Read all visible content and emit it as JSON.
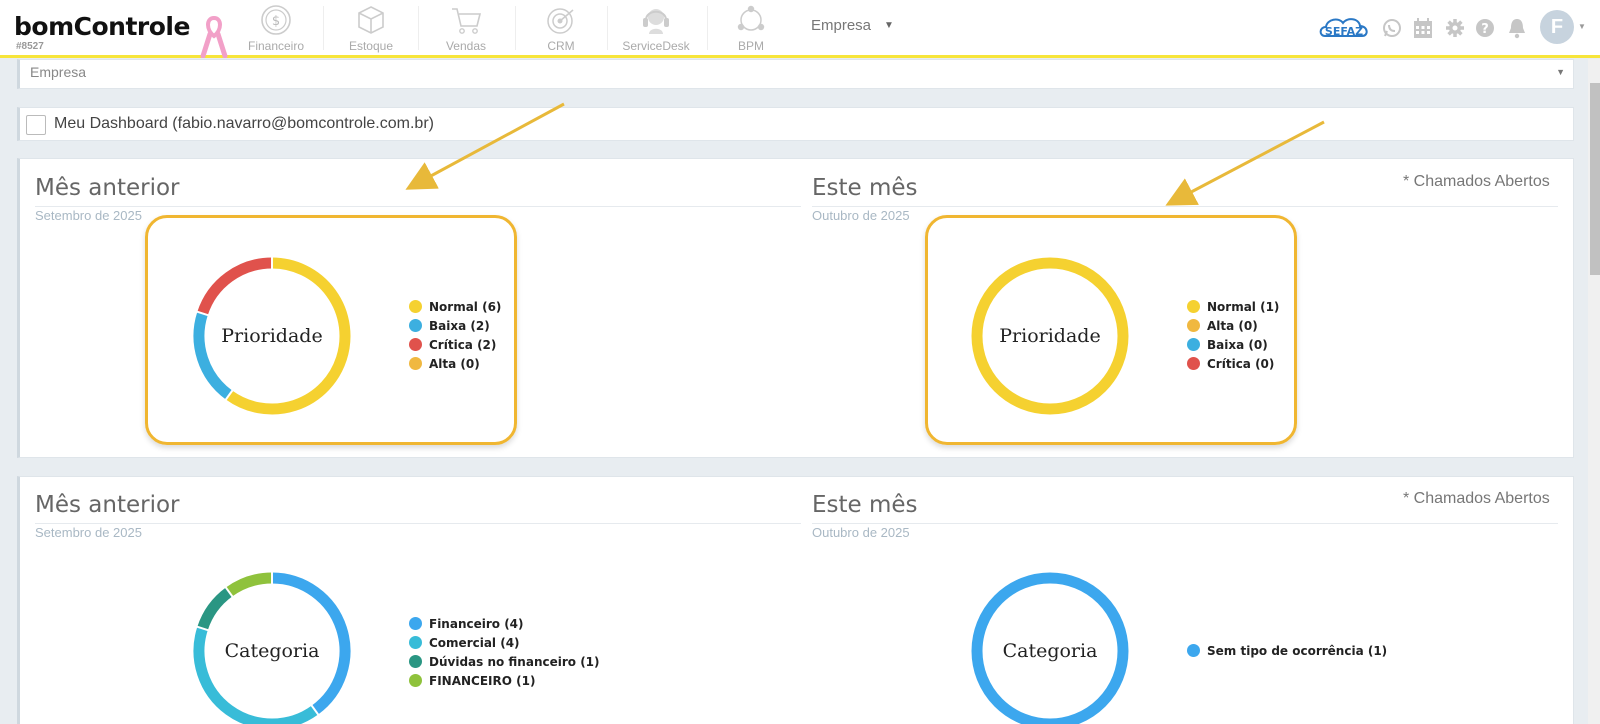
{
  "brand": {
    "name": "bomControle",
    "code": "#8527"
  },
  "nav": [
    {
      "label": "Financeiro",
      "icon": "dollar-icon"
    },
    {
      "label": "Estoque",
      "icon": "box-icon"
    },
    {
      "label": "Vendas",
      "icon": "cart-icon"
    },
    {
      "label": "CRM",
      "icon": "target-icon"
    },
    {
      "label": "ServiceDesk",
      "icon": "headset-icon"
    },
    {
      "label": "BPM",
      "icon": "bpm-icon"
    }
  ],
  "company_menu": "Empresa",
  "header_icons": [
    "sefaz-badge",
    "whatsapp-icon",
    "calendar-icon",
    "gear-icon",
    "help-icon",
    "bell-icon"
  ],
  "sefaz_label": "SEFAZ",
  "user_initial": "F",
  "filters": {
    "empresa_select": "Empresa",
    "meu_dashboard": "Meu Dashboard (fabio.navarro@bomcontrole.com.br)"
  },
  "panels": [
    {
      "note": "* Chamados Abertos",
      "left": {
        "title": "Mês anterior",
        "subtitle": "Setembro de 2025"
      },
      "right": {
        "title": "Este mês",
        "subtitle": "Outubro de 2025"
      }
    },
    {
      "note": "* Chamados Abertos",
      "left": {
        "title": "Mês anterior",
        "subtitle": "Setembro de 2025"
      },
      "right": {
        "title": "Este mês",
        "subtitle": "Outubro de 2025"
      }
    }
  ],
  "chart_data": [
    {
      "type": "pie",
      "center_label": "Prioridade",
      "period": "Setembro de 2025",
      "slices": [
        {
          "label": "Normal (6)",
          "value": 6,
          "color": "#f5d130"
        },
        {
          "label": "Baixa (2)",
          "value": 2,
          "color": "#3cafe0"
        },
        {
          "label": "Crítica (2)",
          "value": 2,
          "color": "#e0524c"
        },
        {
          "label": "Alta (0)",
          "value": 0,
          "color": "#f0b840"
        }
      ]
    },
    {
      "type": "pie",
      "center_label": "Prioridade",
      "period": "Outubro de 2025",
      "slices": [
        {
          "label": "Normal (1)",
          "value": 1,
          "color": "#f5d130"
        },
        {
          "label": "Alta (0)",
          "value": 0,
          "color": "#f0b840"
        },
        {
          "label": "Baixa (0)",
          "value": 0,
          "color": "#3cafe0"
        },
        {
          "label": "Crítica (0)",
          "value": 0,
          "color": "#e0524c"
        }
      ]
    },
    {
      "type": "pie",
      "center_label": "Categoria",
      "period": "Setembro de 2025",
      "slices": [
        {
          "label": "Financeiro (4)",
          "value": 4,
          "color": "#3ca7ee"
        },
        {
          "label": "Comercial (4)",
          "value": 4,
          "color": "#38bcd8"
        },
        {
          "label": "Dúvidas no financeiro (1)",
          "value": 1,
          "color": "#2a9683"
        },
        {
          "label": "FINANCEIRO (1)",
          "value": 1,
          "color": "#8fc23c"
        }
      ]
    },
    {
      "type": "pie",
      "center_label": "Categoria",
      "period": "Outubro de 2025",
      "slices": [
        {
          "label": "Sem tipo de ocorrência (1)",
          "value": 1,
          "color": "#3ca7ee"
        }
      ]
    }
  ],
  "accent_colors": {
    "topbar_border": "#f7e53a",
    "highlight": "#f0b631",
    "arrow": "#e8b93a"
  }
}
